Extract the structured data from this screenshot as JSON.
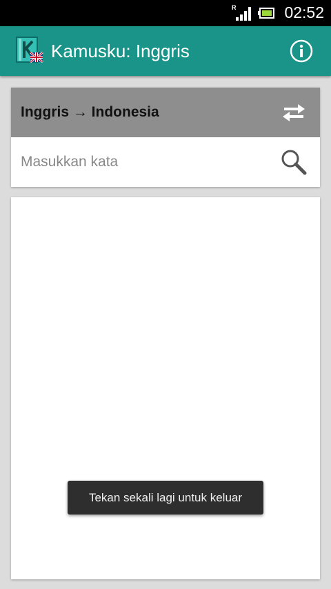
{
  "status_bar": {
    "time": "02:52",
    "roaming_indicator": "R",
    "icons": [
      "signal-icon",
      "battery-icon"
    ]
  },
  "action_bar": {
    "title": "Kamusku: Inggris",
    "logo_icon": "app-logo-icon",
    "info_icon": "info-icon",
    "color": "#1a9489"
  },
  "language_selector": {
    "label": "Inggris → Indonesia",
    "swap_icon": "swap-arrows-icon"
  },
  "search": {
    "placeholder": "Masukkan kata",
    "value": "",
    "icon": "search-icon"
  },
  "toast": {
    "message": "Tekan sekali lagi untuk keluar"
  }
}
